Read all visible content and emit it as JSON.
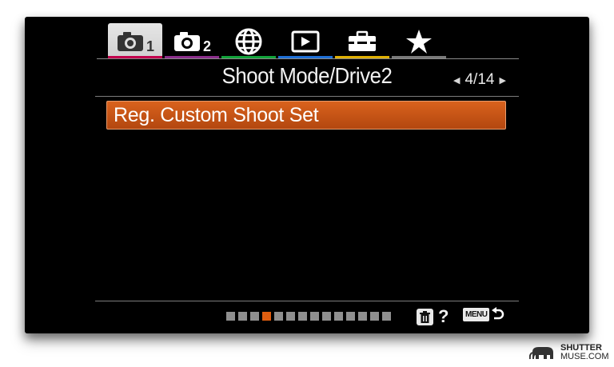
{
  "tabs": [
    {
      "icon": "camera-icon",
      "number": "1",
      "stripe": "#c2004d",
      "active": true
    },
    {
      "icon": "camera-icon",
      "number": "2",
      "stripe": "#8c2f8c",
      "active": false
    },
    {
      "icon": "globe-icon",
      "number": "",
      "stripe": "#12a33a",
      "active": false
    },
    {
      "icon": "playback-icon",
      "number": "",
      "stripe": "#1e6fd6",
      "active": false
    },
    {
      "icon": "toolbox-icon",
      "number": "",
      "stripe": "#e0b000",
      "active": false
    },
    {
      "icon": "star-icon",
      "number": "",
      "stripe": "#7a7a7a",
      "active": false
    }
  ],
  "header": {
    "title": "Shoot Mode/Drive2",
    "page_indicator": "4/14"
  },
  "menu": {
    "items": [
      {
        "label": "Reg. Custom Shoot Set",
        "selected": true
      }
    ]
  },
  "footer": {
    "page_dots": {
      "total": 14,
      "active_index": 4
    },
    "help_label": "?",
    "menu_label": "MENU",
    "accent": "#e05e10"
  },
  "watermark": {
    "line1": "SHUTTER",
    "line2": "MUSE.COM"
  }
}
